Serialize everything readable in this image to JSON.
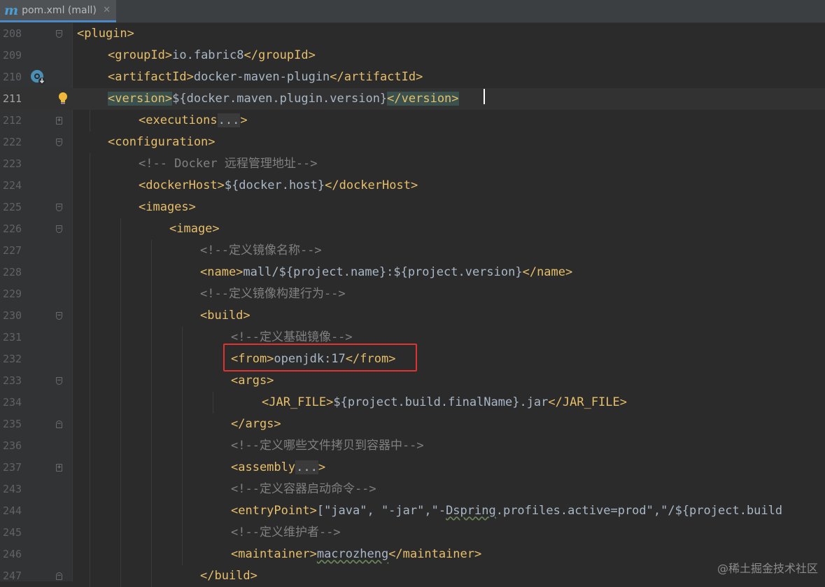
{
  "tab": {
    "icon": "m",
    "title": "pom.xml (mall)",
    "close": "✕"
  },
  "watermark": "@稀土掘金技术社区",
  "lines": [
    {
      "num": "208",
      "fold": "open",
      "indent": 0,
      "parts": [
        [
          "t",
          "<plugin>"
        ]
      ]
    },
    {
      "num": "209",
      "indent": 1,
      "parts": [
        [
          "t",
          "<groupId>"
        ],
        [
          "v",
          "io.fabric8"
        ],
        [
          "t",
          "</groupId>"
        ]
      ]
    },
    {
      "num": "210",
      "gear": true,
      "indent": 1,
      "parts": [
        [
          "t",
          "<artifactId>"
        ],
        [
          "v",
          "docker-maven-plugin"
        ],
        [
          "t",
          "</artifactId>"
        ]
      ]
    },
    {
      "num": "211",
      "current": true,
      "bulb": true,
      "indent": 1,
      "parts": [
        [
          "tm",
          "<version>"
        ],
        [
          "v",
          "${docker.maven.plugin.version}"
        ],
        [
          "tm",
          "</version>"
        ]
      ]
    },
    {
      "num": "212",
      "fold": "plus",
      "indent": 2,
      "parts": [
        [
          "t",
          "<executions"
        ],
        [
          "d",
          "..."
        ],
        [
          "t",
          ">"
        ]
      ]
    },
    {
      "num": "222",
      "fold": "open",
      "indent": 1,
      "parts": [
        [
          "t",
          "<configuration>"
        ]
      ]
    },
    {
      "num": "223",
      "indent": 2,
      "parts": [
        [
          "c",
          "<!-- Docker 远程管理地址-->"
        ]
      ]
    },
    {
      "num": "224",
      "indent": 2,
      "parts": [
        [
          "t",
          "<dockerHost>"
        ],
        [
          "v",
          "${docker.host}"
        ],
        [
          "t",
          "</dockerHost>"
        ]
      ]
    },
    {
      "num": "225",
      "fold": "open",
      "indent": 2,
      "parts": [
        [
          "t",
          "<images>"
        ]
      ]
    },
    {
      "num": "226",
      "fold": "open",
      "indent": 3,
      "parts": [
        [
          "t",
          "<image>"
        ]
      ]
    },
    {
      "num": "227",
      "indent": 4,
      "parts": [
        [
          "c",
          "<!--定义镜像名称-->"
        ]
      ]
    },
    {
      "num": "228",
      "indent": 4,
      "parts": [
        [
          "t",
          "<name>"
        ],
        [
          "v",
          "mall/${project.name}:${project.version}"
        ],
        [
          "t",
          "</name>"
        ]
      ]
    },
    {
      "num": "229",
      "indent": 4,
      "parts": [
        [
          "c",
          "<!--定义镜像构建行为-->"
        ]
      ]
    },
    {
      "num": "230",
      "fold": "open",
      "indent": 4,
      "parts": [
        [
          "t",
          "<build>"
        ]
      ]
    },
    {
      "num": "231",
      "indent": 5,
      "parts": [
        [
          "c",
          "<!--定义基础镜像-->"
        ]
      ]
    },
    {
      "num": "232",
      "indent": 5,
      "parts": [
        [
          "t",
          "<from>"
        ],
        [
          "v",
          "openjdk:17"
        ],
        [
          "t",
          "</from>"
        ]
      ]
    },
    {
      "num": "233",
      "fold": "open",
      "indent": 5,
      "parts": [
        [
          "t",
          "<args>"
        ]
      ]
    },
    {
      "num": "234",
      "indent": 6,
      "parts": [
        [
          "t",
          "<JAR_FILE>"
        ],
        [
          "v",
          "${project.build.finalName}.jar"
        ],
        [
          "t",
          "</JAR_FILE>"
        ]
      ]
    },
    {
      "num": "235",
      "fold": "close",
      "indent": 5,
      "parts": [
        [
          "t",
          "</args>"
        ]
      ]
    },
    {
      "num": "236",
      "indent": 5,
      "parts": [
        [
          "c",
          "<!--定义哪些文件拷贝到容器中-->"
        ]
      ]
    },
    {
      "num": "237",
      "fold": "plus",
      "indent": 5,
      "parts": [
        [
          "t",
          "<assembly"
        ],
        [
          "d",
          "..."
        ],
        [
          "t",
          ">"
        ]
      ]
    },
    {
      "num": "243",
      "indent": 5,
      "parts": [
        [
          "c",
          "<!--定义容器启动命令-->"
        ]
      ]
    },
    {
      "num": "244",
      "indent": 5,
      "parts": [
        [
          "t",
          "<entryPoint>"
        ],
        [
          "v",
          "[\"java\", \"-jar\",\"-"
        ],
        [
          "w",
          "Dspring"
        ],
        [
          "v",
          ".profiles.active=prod\",\"/${project.build"
        ]
      ]
    },
    {
      "num": "245",
      "indent": 5,
      "parts": [
        [
          "c",
          "<!--定义维护者-->"
        ]
      ]
    },
    {
      "num": "246",
      "indent": 5,
      "parts": [
        [
          "t",
          "<maintainer>"
        ],
        [
          "w",
          "macrozheng"
        ],
        [
          "t",
          "</maintainer>"
        ]
      ]
    },
    {
      "num": "247",
      "fold": "close",
      "indent": 4,
      "parts": [
        [
          "t",
          "</build>"
        ]
      ]
    }
  ]
}
